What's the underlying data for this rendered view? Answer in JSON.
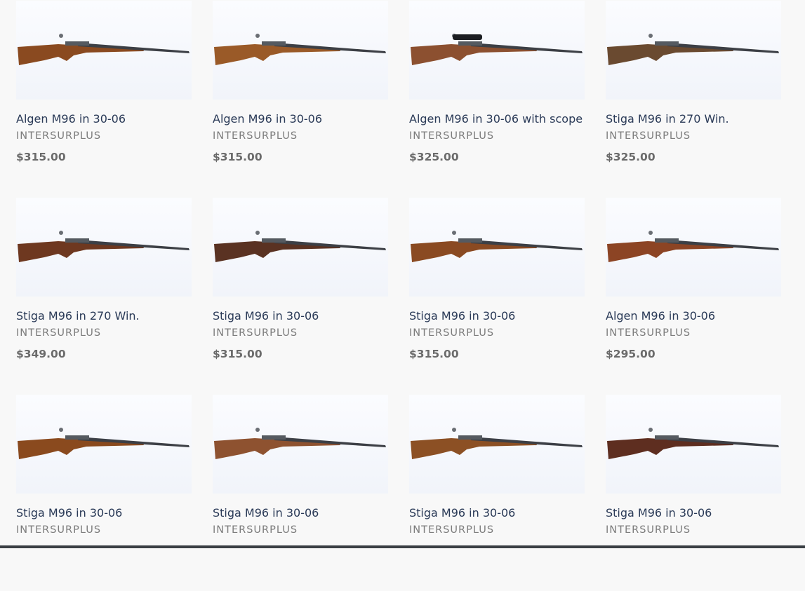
{
  "products": [
    {
      "title": "Algen M96 in 30-06",
      "vendor": "INTERSURPLUS",
      "price": "$315.00",
      "stock": "#8a4a20",
      "scope": false
    },
    {
      "title": "Algen M96 in 30-06",
      "vendor": "INTERSURPLUS",
      "price": "$315.00",
      "stock": "#9a5a28",
      "scope": false
    },
    {
      "title": "Algen M96 in 30-06 with scope",
      "vendor": "INTERSURPLUS",
      "price": "$325.00",
      "stock": "#8c5030",
      "scope": true
    },
    {
      "title": "Stiga M96 in 270 Win.",
      "vendor": "INTERSURPLUS",
      "price": "$325.00",
      "stock": "#6a4a30",
      "scope": false
    },
    {
      "title": "Stiga M96 in 270 Win.",
      "vendor": "INTERSURPLUS",
      "price": "$349.00",
      "stock": "#6e3820",
      "scope": false
    },
    {
      "title": "Stiga M96 in 30-06",
      "vendor": "INTERSURPLUS",
      "price": "$315.00",
      "stock": "#5a3222",
      "scope": false
    },
    {
      "title": "Stiga M96 in 30-06",
      "vendor": "INTERSURPLUS",
      "price": "$315.00",
      "stock": "#8a4a22",
      "scope": false
    },
    {
      "title": "Algen M96 in 30-06",
      "vendor": "INTERSURPLUS",
      "price": "$295.00",
      "stock": "#8c4424",
      "scope": false
    },
    {
      "title": "Stiga M96 in 30-06",
      "vendor": "INTERSURPLUS",
      "price": "",
      "stock": "#8a4a1e",
      "scope": false
    },
    {
      "title": "Stiga M96 in 30-06",
      "vendor": "INTERSURPLUS",
      "price": "",
      "stock": "#8e5230",
      "scope": false
    },
    {
      "title": "Stiga M96 in 30-06",
      "vendor": "INTERSURPLUS",
      "price": "",
      "stock": "#8c5024",
      "scope": false
    },
    {
      "title": "Stiga M96 in 30-06",
      "vendor": "INTERSURPLUS",
      "price": "",
      "stock": "#5e2e20",
      "scope": false
    }
  ],
  "colors": {
    "title": "#2a3a57",
    "vendor": "#7c7c7c",
    "price": "#6b6b6b",
    "barrel": "#3c3f45",
    "background": "#f8f8f8"
  }
}
